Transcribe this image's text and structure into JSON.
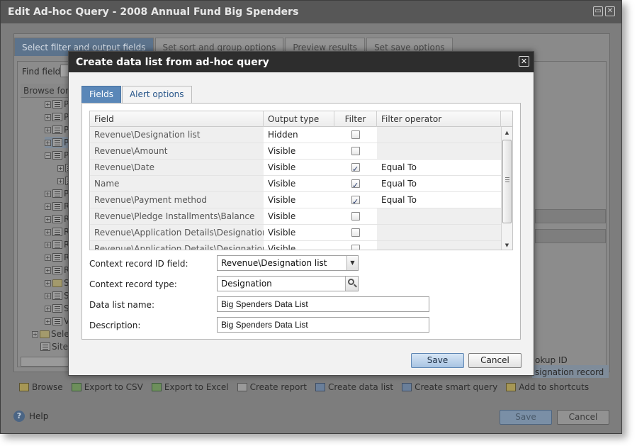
{
  "window": {
    "title": "Edit Ad-hoc Query - 2008 Annual Fund Big Spenders",
    "tabs": [
      {
        "label": "Select filter and output fields"
      },
      {
        "label": "Set sort and group options"
      },
      {
        "label": "Preview results"
      },
      {
        "label": "Set save options"
      }
    ],
    "find_field_label": "Find field:",
    "browse_label": "Browse for fi",
    "tree_items": [
      {
        "label": "P"
      },
      {
        "label": "P"
      },
      {
        "label": "P"
      },
      {
        "label": "P"
      },
      {
        "label": "P"
      },
      {
        "label": ""
      },
      {
        "label": ""
      },
      {
        "label": "P"
      },
      {
        "label": "R"
      },
      {
        "label": "R"
      },
      {
        "label": "R"
      },
      {
        "label": "R"
      },
      {
        "label": "R"
      },
      {
        "label": "R"
      },
      {
        "label": "S"
      },
      {
        "label": "S"
      },
      {
        "label": "S"
      },
      {
        "label": "V"
      },
      {
        "label": "Sele"
      },
      {
        "label": "Sites"
      }
    ],
    "right_lookup_text": "okup ID",
    "right_designation_text": "signation record",
    "toolbar": [
      {
        "label": "Browse",
        "icon": "browse-icon"
      },
      {
        "label": "Export to CSV",
        "icon": "csv-icon"
      },
      {
        "label": "Export to Excel",
        "icon": "excel-icon"
      },
      {
        "label": "Create report",
        "icon": "report-icon"
      },
      {
        "label": "Create data list",
        "icon": "data-list-icon"
      },
      {
        "label": "Create smart query",
        "icon": "smart-query-icon"
      },
      {
        "label": "Add to shortcuts",
        "icon": "shortcut-icon"
      }
    ],
    "help_label": "Help",
    "save_label": "Save",
    "cancel_label": "Cancel"
  },
  "dialog": {
    "title": "Create data list from ad-hoc query",
    "tabs": [
      {
        "label": "Fields"
      },
      {
        "label": "Alert options"
      }
    ],
    "grid": {
      "columns": [
        "Field",
        "Output type",
        "Filter",
        "Filter operator"
      ],
      "rows": [
        {
          "field": "Revenue\\Designation list",
          "output": "Hidden",
          "filter": false,
          "operator": ""
        },
        {
          "field": "Revenue\\Amount",
          "output": "Visible",
          "filter": false,
          "operator": ""
        },
        {
          "field": "Revenue\\Date",
          "output": "Visible",
          "filter": true,
          "operator": "Equal To"
        },
        {
          "field": "Name",
          "output": "Visible",
          "filter": true,
          "operator": "Equal To"
        },
        {
          "field": "Revenue\\Payment method",
          "output": "Visible",
          "filter": true,
          "operator": "Equal To"
        },
        {
          "field": "Revenue\\Pledge Installments\\Balance",
          "output": "Visible",
          "filter": false,
          "operator": ""
        },
        {
          "field": "Revenue\\Application Details\\Designation\\...",
          "output": "Visible",
          "filter": false,
          "operator": ""
        },
        {
          "field": "Revenue\\Application Details\\Designation\\...",
          "output": "Visible",
          "filter": false,
          "operator": ""
        }
      ]
    },
    "context_record_id_field": {
      "label": "Context record ID field:",
      "value": "Revenue\\Designation list"
    },
    "context_record_type": {
      "label": "Context record type:",
      "value": "Designation"
    },
    "data_list_name": {
      "label": "Data list name:",
      "value": "Big Spenders Data List"
    },
    "description": {
      "label": "Description:",
      "value": "Big Spenders Data List"
    },
    "save_label": "Save",
    "cancel_label": "Cancel"
  }
}
